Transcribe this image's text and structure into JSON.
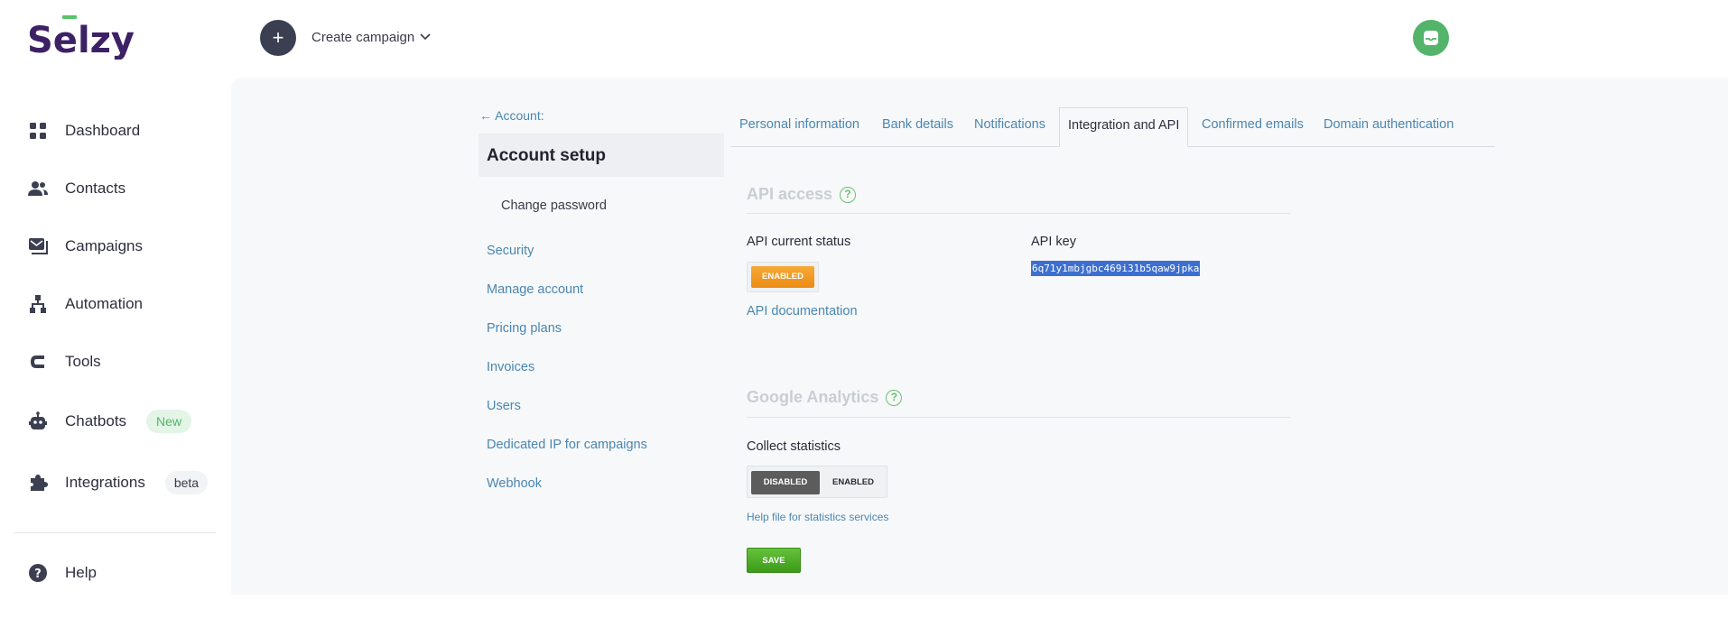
{
  "brand": {
    "logo_text": "Sēlzy"
  },
  "header": {
    "create_label": "Create campaign"
  },
  "sidebar": {
    "items": [
      {
        "label": "Dashboard",
        "icon": "dashboard-icon"
      },
      {
        "label": "Contacts",
        "icon": "contacts-icon"
      },
      {
        "label": "Campaigns",
        "icon": "campaigns-icon"
      },
      {
        "label": "Automation",
        "icon": "automation-icon"
      },
      {
        "label": "Tools",
        "icon": "tools-icon"
      },
      {
        "label": "Chatbots",
        "icon": "chatbot-icon",
        "badge": "New"
      },
      {
        "label": "Integrations",
        "icon": "puzzle-icon",
        "badge": "beta"
      }
    ],
    "help": "Help"
  },
  "account": {
    "back": "← Account:",
    "title": "Account setup",
    "links": [
      "Change password",
      "Security",
      "Manage account",
      "Pricing plans",
      "Invoices",
      "Users",
      "Dedicated IP for campaigns",
      "Webhook"
    ]
  },
  "tabs": [
    "Personal information",
    "Bank details",
    "Notifications",
    "Integration and API",
    "Confirmed emails",
    "Domain authentication"
  ],
  "api": {
    "title": "API access",
    "status_label": "API current status",
    "status_value": "ENABLED",
    "key_label": "API key",
    "key_value": "6q71y1mbjgbc469i31b5qaw9jpka",
    "doc_link": "API documentation"
  },
  "ga": {
    "title": "Google Analytics",
    "collect_label": "Collect statistics",
    "toggle_off": "DISABLED",
    "toggle_on": "ENABLED",
    "help_link": "Help file for statistics services",
    "save": "SAVE"
  },
  "colors": {
    "accent": "#4a86b0",
    "brand": "#3d2166",
    "green": "#53b46a",
    "orange": "#eb8b13"
  }
}
